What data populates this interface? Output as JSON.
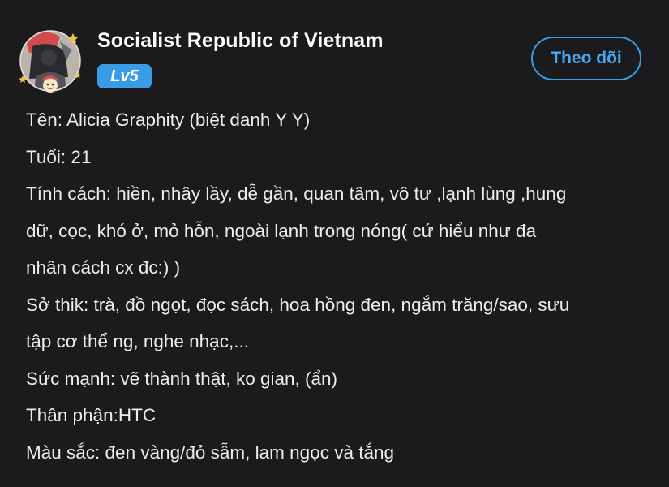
{
  "profile": {
    "username": "Socialist Republic of Vietnam",
    "level": "Lv5",
    "follow_label": "Theo dõi",
    "avatar_icon": "profile-avatar-icon"
  },
  "bio": {
    "lines": [
      "Tên: Alicia Graphity (biệt danh Y Y)",
      "Tuổi: 21",
      "Tính cách: hiền, nhây lầy, dễ gần, quan tâm, vô tư ,lạnh lùng ,hung",
      "dữ, cọc, khó ở, mỏ hỗn, ngoài lạnh trong nóng( cứ hiểu như đa",
      "nhân cách cx đc:) )",
      "Sở thik: trà, đồ ngọt, đọc sách, hoa hồng đen, ngắm trăng/sao, sưu",
      "tập cơ thể ng, nghe nhạc,...",
      "Sức mạnh: vẽ thành thật, ko gian, (ẩn)",
      "Thân phận:HTC",
      "Màu sắc: đen vàng/đỏ sẫm, lam ngọc và tắng"
    ]
  },
  "colors": {
    "background": "#1b1b1d",
    "accent": "#3a9be6",
    "text": "#ececec"
  }
}
